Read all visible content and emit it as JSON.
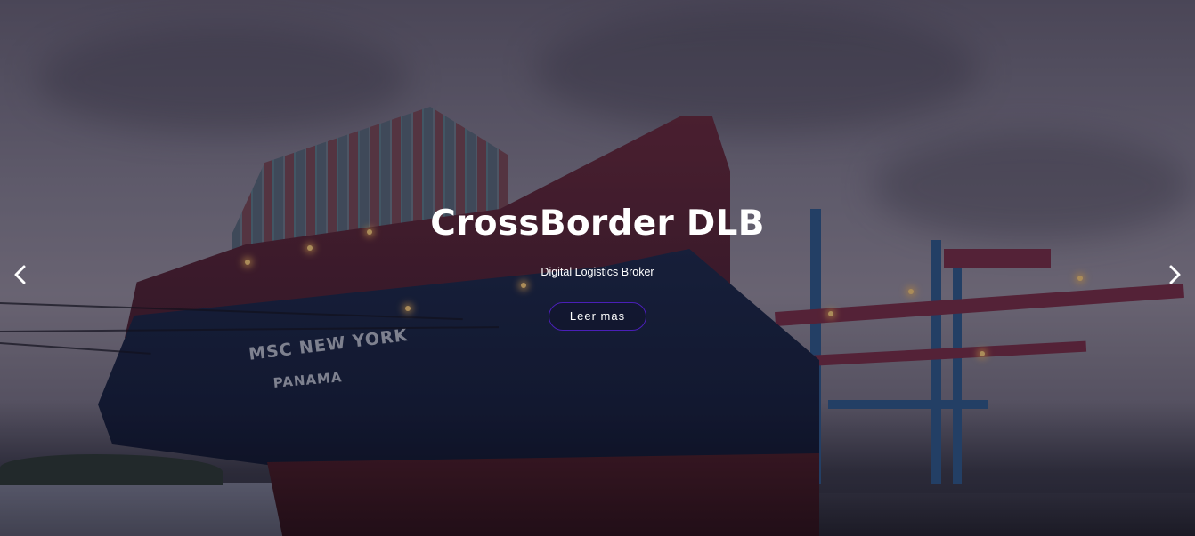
{
  "hero": {
    "title": "CrossBorder DLB",
    "subtitle": "Digital Logistics Broker",
    "cta_label": "Leer mas"
  },
  "slider": {
    "prev_icon": "chevron-left-icon",
    "next_icon": "chevron-right-icon"
  },
  "background_image": {
    "ship_name": "MSC NEW YORK",
    "ship_port": "PANAMA"
  },
  "colors": {
    "button_border": "#4a1fb8",
    "text": "#ffffff"
  }
}
